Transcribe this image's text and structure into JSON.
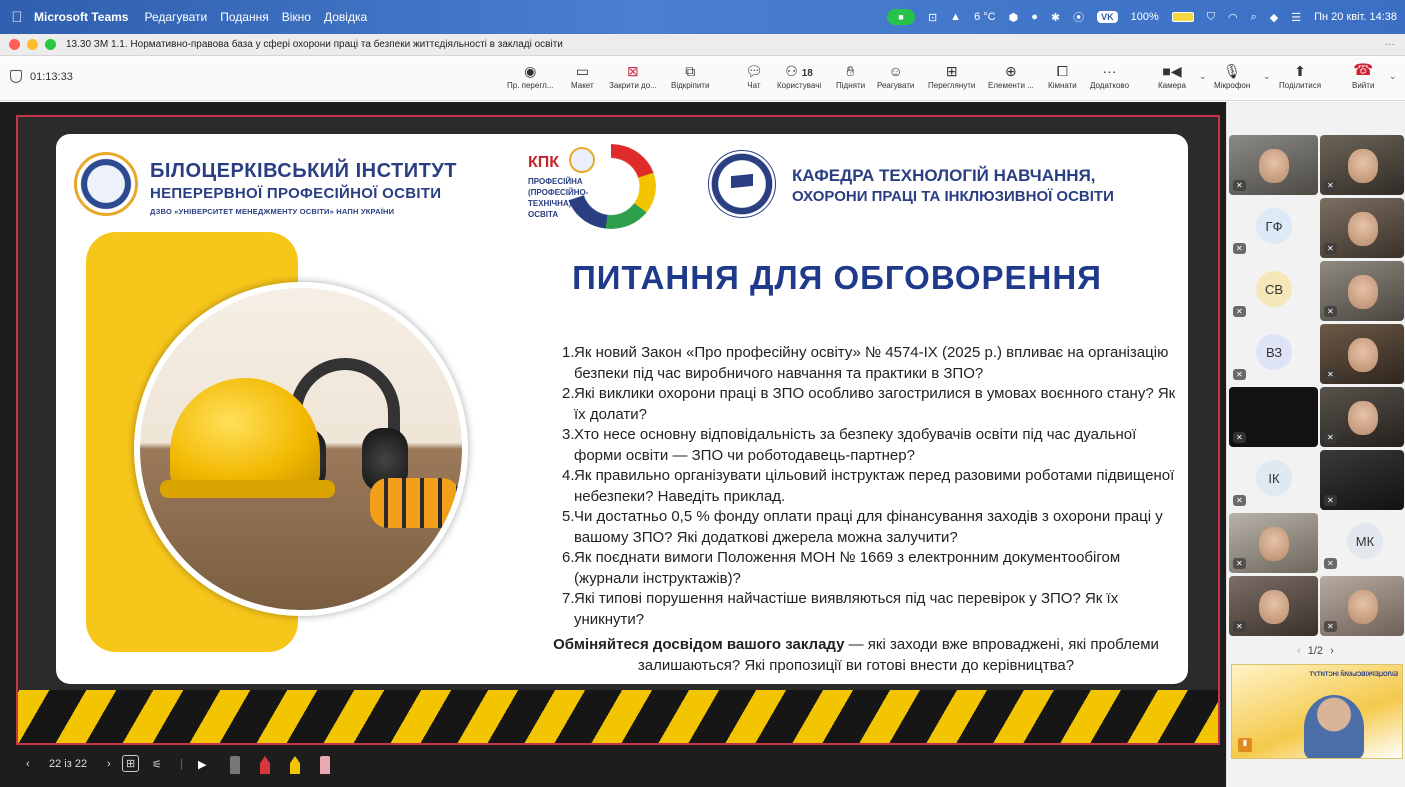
{
  "menubar": {
    "app_name": "Microsoft Teams",
    "menus": [
      "Редагувати",
      "Подання",
      "Вікно",
      "Довідка"
    ],
    "weather": "6 °C",
    "vk": "VK",
    "battery": "100%",
    "datetime": "Пн 20 квіт. 14:38"
  },
  "window": {
    "title": "13.30 ЗМ 1.1. Нормативно-правова база у сфері охорони праці та безпеки життєдіяльності в закладі освіти",
    "more": "···"
  },
  "toolbar": {
    "timer": "01:13:33",
    "buttons": {
      "preview": "Пр. перегл...",
      "layout": "Макет",
      "close_share": "Закрити до...",
      "popout": "Відкріпити",
      "chat": "Чат",
      "people_count": "18",
      "people": "Користувачі",
      "raise": "Підняти",
      "react": "Реагувати",
      "view": "Переглянути",
      "elements": "Елементи ...",
      "rooms": "Кімнати",
      "more": "Додатково",
      "camera": "Камера",
      "mic": "Мікрофон",
      "share": "Поділитися",
      "leave": "Вийти"
    },
    "colors": {
      "close_share": "#c4314b",
      "leave": "#d12031"
    }
  },
  "slide": {
    "institute_line1": "БІЛОЦЕРКІВСЬКИЙ ІНСТИТУТ",
    "institute_line2": "НЕПЕРЕРВНОЇ ПРОФЕСІЙНОЇ ОСВІТИ",
    "institute_line3": "ДЗВО «УНІВЕРСИТЕТ МЕНЕДЖМЕНТУ ОСВІТИ» НАПН УКРАЇНИ",
    "kpk_title": "КПК",
    "kpk_sub": "ПРОФЕСІЙНА (ПРОФЕСІЙНО-ТЕХНІЧНА) ОСВІТА",
    "dept_line1": "КАФЕДРА ТЕХНОЛОГІЙ НАВЧАННЯ,",
    "dept_line2": "ОХОРОНИ ПРАЦІ ТА ІНКЛЮЗИВНОЇ ОСВІТИ",
    "heading": "ПИТАННЯ ДЛЯ ОБГОВОРЕННЯ",
    "questions": [
      {
        "n": "1.",
        "text": "Як новий Закон «Про професійну освіту» № 4574-IX (2025 р.) впливає на організацію безпеки під час виробничого навчання та практики в ЗПО?"
      },
      {
        "n": "2.",
        "text": "Які виклики охорони праці в ЗПО особливо загострилися в умовах воєнного стану? Як їх долати?"
      },
      {
        "n": "3.",
        "text": "Хто несе основну відповідальність за безпеку здобувачів освіти під час дуальної форми освіти — ЗПО чи роботодавець-партнер?"
      },
      {
        "n": "4.",
        "text": "Як правильно організувати цільовий інструктаж перед разовими роботами підвищеної небезпеки? Наведіть приклад."
      },
      {
        "n": "5.",
        "text": "Чи достатньо 0,5 % фонду оплати праці для фінансування заходів з охорони праці у вашому ЗПО? Які додаткові джерела можна залучити?"
      },
      {
        "n": "6.",
        "text": "Як поєднати вимоги Положення МОН № 1669 з електронним документообігом (журнали інструктажів)?"
      },
      {
        "n": "7.",
        "text": "Які типові порушення найчастіше виявляються під час перевірок у ЗПО? Як їх уникнути?"
      }
    ],
    "closing_bold": "Обміняйтеся досвідом вашого закладу",
    "closing_rest": " — які заходи вже впроваджені, які проблеми залишаються? Які пропозиції ви готові внести до керівництва?",
    "colors": {
      "heading": "#1f3a8a",
      "border": "#c6364b",
      "yellow": "#f7c61b"
    }
  },
  "bottombar": {
    "prev": "‹",
    "counter": "22 із 22",
    "next": "›"
  },
  "sidebar": {
    "initials": [
      "ГФ",
      "СВ",
      "ВЗ",
      "ІК",
      "МК"
    ],
    "pager": "1/2"
  }
}
